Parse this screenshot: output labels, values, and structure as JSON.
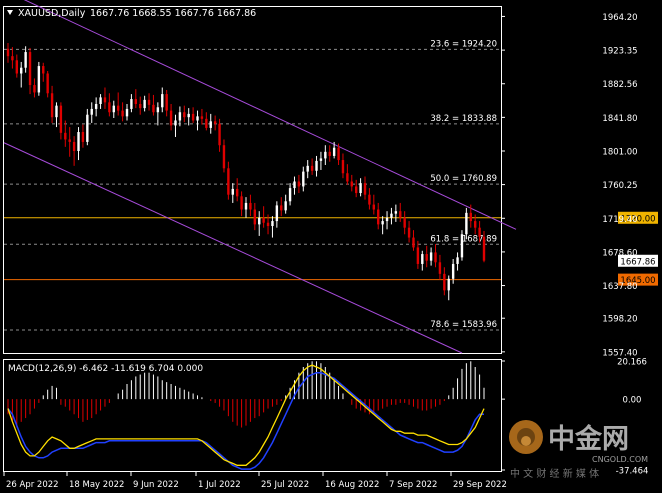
{
  "header": {
    "symbol": "XAUUSD,Daily",
    "ohlc": "1667.76 1668.55 1667.76 1667.86"
  },
  "price_axis": {
    "ticks": [
      "1964.20",
      "1923.35",
      "1882.56",
      "1841.80",
      "1801.00",
      "1760.25",
      "1719.40",
      "1678.60",
      "1637.80",
      "1598.20",
      "1557.40"
    ],
    "tick_values": [
      1964.2,
      1923.35,
      1882.56,
      1841.8,
      1801.0,
      1760.25,
      1719.4,
      1678.6,
      1637.8,
      1598.2,
      1557.4
    ],
    "ylim": [
      1548,
      1976
    ]
  },
  "fib_levels": [
    {
      "label": "23.6 = 1924.20",
      "value": 1924.2
    },
    {
      "label": "38.2 = 1833.88",
      "value": 1833.88
    },
    {
      "label": "50.0 = 1760.89",
      "value": 1760.89
    },
    {
      "label": "61.8 = 1687.89",
      "value": 1687.89
    },
    {
      "label": "78.6 = 1583.96",
      "value": 1583.96
    }
  ],
  "horizontal_lines": [
    {
      "label": "1720.00",
      "value": 1720.0,
      "color": "#f0b400"
    },
    {
      "label": "1645.00",
      "value": 1645.0,
      "color": "#f06a00"
    }
  ],
  "current_price_label": "1667.86",
  "channel": {
    "color": "#a64bd9",
    "upper": {
      "start_value": 1996,
      "end_value": 1706
    },
    "lower": {
      "start_value": 1811,
      "end_value": 1556
    }
  },
  "time_axis": {
    "labels": [
      "26 Apr 2022",
      "18 May 2022",
      "9 Jun 2022",
      "1 Jul 2022",
      "25 Jul 2022",
      "16 Aug 2022",
      "7 Sep 2022",
      "29 Sep 2022"
    ]
  },
  "macd_panel": {
    "label": "MACD(12,26,9) -6.462 -11.619 6.704 0.000",
    "ticks": [
      "20.166",
      "0.00",
      "-37.464"
    ],
    "tick_values": [
      20.166,
      0,
      -37.464
    ],
    "ylim": [
      -37.464,
      20.166
    ]
  },
  "watermark": {
    "brand": "中金网",
    "domain": "CNGOLD.COM",
    "tagline": "中 文 财 经 新 媒 体"
  },
  "colors": {
    "bull": "#ffffff",
    "bear": "#e00000",
    "grid_dash": "#8c8c8c",
    "macd_line": "#ffe000",
    "signal_line": "#2040ff",
    "text": "#ffffff"
  },
  "chart_data": [
    {
      "type": "candlestick",
      "title": "XAUUSD,Daily",
      "ohlc": [
        [
          1925,
          1932,
          1908,
          1916
        ],
        [
          1916,
          1927,
          1901,
          1911
        ],
        [
          1911,
          1918,
          1890,
          1895
        ],
        [
          1895,
          1909,
          1878,
          1902
        ],
        [
          1902,
          1928,
          1896,
          1921
        ],
        [
          1921,
          1926,
          1870,
          1881
        ],
        [
          1881,
          1889,
          1866,
          1872
        ],
        [
          1872,
          1909,
          1868,
          1904
        ],
        [
          1904,
          1908,
          1885,
          1895
        ],
        [
          1895,
          1898,
          1866,
          1871
        ],
        [
          1871,
          1880,
          1835,
          1842
        ],
        [
          1842,
          1860,
          1830,
          1856
        ],
        [
          1856,
          1860,
          1815,
          1823
        ],
        [
          1823,
          1838,
          1806,
          1815
        ],
        [
          1815,
          1830,
          1794,
          1812
        ],
        [
          1812,
          1819,
          1783,
          1801
        ],
        [
          1801,
          1830,
          1790,
          1824
        ],
        [
          1824,
          1833,
          1805,
          1812
        ],
        [
          1812,
          1852,
          1808,
          1845
        ],
        [
          1845,
          1860,
          1835,
          1852
        ],
        [
          1852,
          1866,
          1843,
          1858
        ],
        [
          1858,
          1870,
          1852,
          1866
        ],
        [
          1866,
          1878,
          1852,
          1860
        ],
        [
          1860,
          1871,
          1843,
          1848
        ],
        [
          1848,
          1862,
          1841,
          1856
        ],
        [
          1856,
          1872,
          1844,
          1850
        ],
        [
          1850,
          1860,
          1837,
          1843
        ],
        [
          1843,
          1858,
          1838,
          1852
        ],
        [
          1852,
          1870,
          1848,
          1864
        ],
        [
          1864,
          1876,
          1853,
          1858
        ],
        [
          1858,
          1867,
          1845,
          1853
        ],
        [
          1853,
          1868,
          1849,
          1863
        ],
        [
          1863,
          1871,
          1850,
          1857
        ],
        [
          1857,
          1869,
          1844,
          1848
        ],
        [
          1848,
          1860,
          1832,
          1854
        ],
        [
          1854,
          1878,
          1848,
          1870
        ],
        [
          1870,
          1875,
          1843,
          1850
        ],
        [
          1850,
          1858,
          1826,
          1832
        ],
        [
          1832,
          1845,
          1818,
          1838
        ],
        [
          1838,
          1855,
          1831,
          1848
        ],
        [
          1848,
          1856,
          1836,
          1842
        ],
        [
          1842,
          1853,
          1832,
          1846
        ],
        [
          1846,
          1854,
          1835,
          1838
        ],
        [
          1838,
          1850,
          1826,
          1843
        ],
        [
          1843,
          1852,
          1833,
          1840
        ],
        [
          1840,
          1848,
          1826,
          1829
        ],
        [
          1829,
          1846,
          1822,
          1837
        ],
        [
          1837,
          1844,
          1826,
          1834
        ],
        [
          1834,
          1840,
          1800,
          1808
        ],
        [
          1808,
          1815,
          1775,
          1780
        ],
        [
          1780,
          1788,
          1742,
          1748
        ],
        [
          1748,
          1762,
          1738,
          1755
        ],
        [
          1755,
          1768,
          1740,
          1746
        ],
        [
          1746,
          1752,
          1722,
          1730
        ],
        [
          1730,
          1745,
          1720,
          1738
        ],
        [
          1738,
          1748,
          1722,
          1730
        ],
        [
          1730,
          1738,
          1705,
          1712
        ],
        [
          1712,
          1728,
          1698,
          1720
        ],
        [
          1720,
          1734,
          1708,
          1714
        ],
        [
          1714,
          1724,
          1700,
          1710
        ],
        [
          1710,
          1722,
          1696,
          1716
        ],
        [
          1716,
          1740,
          1708,
          1735
        ],
        [
          1735,
          1745,
          1722,
          1729
        ],
        [
          1729,
          1748,
          1725,
          1740
        ],
        [
          1740,
          1762,
          1735,
          1756
        ],
        [
          1756,
          1770,
          1748,
          1764
        ],
        [
          1764,
          1772,
          1750,
          1758
        ],
        [
          1758,
          1782,
          1752,
          1776
        ],
        [
          1776,
          1790,
          1768,
          1783
        ],
        [
          1783,
          1792,
          1772,
          1777
        ],
        [
          1777,
          1795,
          1770,
          1789
        ],
        [
          1789,
          1800,
          1778,
          1792
        ],
        [
          1792,
          1808,
          1784,
          1800
        ],
        [
          1800,
          1808,
          1788,
          1795
        ],
        [
          1795,
          1812,
          1792,
          1805
        ],
        [
          1805,
          1810,
          1784,
          1790
        ],
        [
          1790,
          1798,
          1768,
          1774
        ],
        [
          1774,
          1785,
          1760,
          1764
        ],
        [
          1764,
          1772,
          1752,
          1758
        ],
        [
          1758,
          1766,
          1745,
          1750
        ],
        [
          1750,
          1768,
          1746,
          1762
        ],
        [
          1762,
          1770,
          1742,
          1748
        ],
        [
          1748,
          1756,
          1730,
          1736
        ],
        [
          1736,
          1748,
          1724,
          1730
        ],
        [
          1730,
          1738,
          1706,
          1712
        ],
        [
          1712,
          1722,
          1700,
          1716
        ],
        [
          1716,
          1728,
          1706,
          1720
        ],
        [
          1720,
          1732,
          1712,
          1725
        ],
        [
          1725,
          1736,
          1715,
          1728
        ],
        [
          1728,
          1738,
          1715,
          1720
        ],
        [
          1720,
          1728,
          1700,
          1708
        ],
        [
          1708,
          1716,
          1690,
          1696
        ],
        [
          1696,
          1705,
          1680,
          1684
        ],
        [
          1684,
          1692,
          1658,
          1664
        ],
        [
          1664,
          1680,
          1656,
          1676
        ],
        [
          1676,
          1686,
          1660,
          1668
        ],
        [
          1668,
          1684,
          1662,
          1678
        ],
        [
          1678,
          1688,
          1660,
          1666
        ],
        [
          1666,
          1675,
          1645,
          1652
        ],
        [
          1652,
          1660,
          1626,
          1632
        ],
        [
          1632,
          1650,
          1620,
          1646
        ],
        [
          1646,
          1670,
          1640,
          1664
        ],
        [
          1664,
          1678,
          1656,
          1672
        ],
        [
          1672,
          1705,
          1668,
          1700
        ],
        [
          1700,
          1732,
          1694,
          1726
        ],
        [
          1726,
          1736,
          1708,
          1716
        ],
        [
          1716,
          1724,
          1700,
          1708
        ],
        [
          1708,
          1716,
          1690,
          1697
        ],
        [
          1697,
          1704,
          1666,
          1668
        ]
      ]
    },
    {
      "type": "bar",
      "title": "MACD(12,26,9) -6.462 -11.619 6.704 0.000",
      "series": [
        {
          "name": "histogram",
          "values": [
            -8,
            -12,
            -15,
            -12,
            -10,
            -8,
            -5,
            -2,
            2,
            5,
            7,
            6,
            -3,
            -4,
            -6,
            -8,
            -10,
            -12,
            -11,
            -10,
            -8,
            -6,
            -4,
            -2,
            0,
            3,
            5,
            8,
            10,
            12,
            13,
            14,
            14,
            13,
            12,
            10,
            9,
            8,
            7,
            6,
            5,
            4,
            3,
            2,
            1,
            0,
            -1,
            -2,
            -4,
            -6,
            -9,
            -12,
            -14,
            -15,
            -14,
            -12,
            -10,
            -9,
            -7,
            -5,
            -4,
            -3,
            -1,
            2,
            6,
            10,
            14,
            17,
            19,
            20,
            20,
            19,
            17,
            14,
            11,
            7,
            3,
            0,
            -3,
            -5,
            -6,
            -7,
            -8,
            -7,
            -6,
            -5,
            -4,
            -3,
            -3,
            -2,
            -2,
            -3,
            -4,
            -5,
            -6,
            -6,
            -5,
            -4,
            -3,
            -1,
            2,
            6,
            11,
            16,
            19,
            20,
            17,
            13,
            6
          ]
        },
        {
          "name": "macd_line",
          "values": [
            -5,
            -12,
            -18,
            -24,
            -28,
            -30,
            -30,
            -28,
            -25,
            -22,
            -20,
            -21,
            -22,
            -24,
            -26,
            -26,
            -25,
            -24,
            -23,
            -22,
            -21,
            -21,
            -21,
            -21,
            -21,
            -21,
            -21,
            -21,
            -21,
            -21,
            -21,
            -21,
            -21,
            -21,
            -21,
            -21,
            -21,
            -21,
            -21,
            -21,
            -21,
            -21,
            -21,
            -21,
            -22,
            -24,
            -26,
            -28,
            -30,
            -32,
            -33,
            -34,
            -35,
            -35,
            -35,
            -33,
            -31,
            -28,
            -24,
            -20,
            -15,
            -10,
            -5,
            0,
            4,
            8,
            12,
            15,
            17,
            18,
            17,
            16,
            14,
            12,
            10,
            8,
            6,
            4,
            2,
            0,
            -2,
            -4,
            -6,
            -8,
            -10,
            -12,
            -14,
            -16,
            -17,
            -17,
            -18,
            -18,
            -18,
            -19,
            -19,
            -19,
            -20,
            -21,
            -22,
            -23,
            -24,
            -24,
            -24,
            -23,
            -21,
            -18,
            -15,
            -10,
            -5
          ]
        },
        {
          "name": "signal_line",
          "values": [
            -5,
            -8,
            -14,
            -20,
            -25,
            -28,
            -30,
            -31,
            -31,
            -30,
            -28,
            -27,
            -26,
            -26,
            -26,
            -26,
            -26,
            -26,
            -25,
            -24,
            -23,
            -23,
            -23,
            -22,
            -22,
            -22,
            -22,
            -22,
            -22,
            -22,
            -22,
            -22,
            -22,
            -22,
            -22,
            -22,
            -22,
            -22,
            -22,
            -22,
            -22,
            -22,
            -22,
            -22,
            -22,
            -23,
            -25,
            -27,
            -29,
            -31,
            -33,
            -35,
            -36,
            -37,
            -37,
            -37,
            -36,
            -34,
            -31,
            -27,
            -23,
            -18,
            -13,
            -8,
            -3,
            2,
            6,
            9,
            12,
            13,
            14,
            14,
            13,
            12,
            11,
            9,
            7,
            5,
            3,
            1,
            -1,
            -3,
            -5,
            -7,
            -9,
            -11,
            -13,
            -15,
            -17,
            -19,
            -20,
            -21,
            -22,
            -23,
            -23,
            -24,
            -25,
            -26,
            -27,
            -28,
            -28,
            -28,
            -27,
            -25,
            -21,
            -16,
            -11,
            -8,
            -8
          ]
        }
      ],
      "ylim": [
        -37.464,
        20.166
      ]
    }
  ]
}
